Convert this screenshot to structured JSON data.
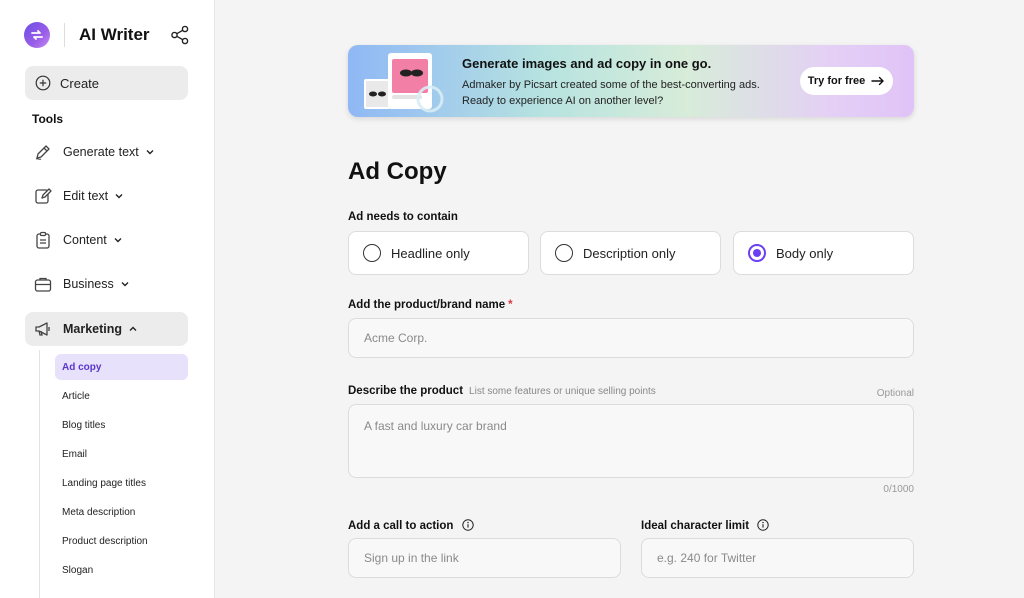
{
  "app": {
    "title": "AI Writer"
  },
  "sidebar": {
    "create_label": "Create",
    "tools_label": "Tools",
    "items": [
      {
        "label": "Generate text",
        "icon": "pen-icon"
      },
      {
        "label": "Edit text",
        "icon": "edit-icon"
      },
      {
        "label": "Content",
        "icon": "clipboard-icon"
      },
      {
        "label": "Business",
        "icon": "briefcase-icon"
      },
      {
        "label": "Marketing",
        "icon": "megaphone-icon"
      }
    ],
    "subitems": [
      {
        "label": "Ad copy"
      },
      {
        "label": "Article"
      },
      {
        "label": "Blog titles"
      },
      {
        "label": "Email"
      },
      {
        "label": "Landing page titles"
      },
      {
        "label": "Meta description"
      },
      {
        "label": "Product description"
      },
      {
        "label": "Slogan"
      }
    ]
  },
  "banner": {
    "title": "Generate images and ad copy in one go.",
    "text": "Admaker by Picsart created some of the best-converting ads. Ready to experience AI on another level?",
    "button_label": "Try for free"
  },
  "form": {
    "page_title": "Ad Copy",
    "contain_label": "Ad needs to contain",
    "options": [
      {
        "label": "Headline only",
        "selected": false
      },
      {
        "label": "Description only",
        "selected": false
      },
      {
        "label": "Body only",
        "selected": true
      }
    ],
    "brand_label": "Add the product/brand name",
    "brand_required": "*",
    "brand_placeholder": "Acme Corp.",
    "describe_label": "Describe the product",
    "describe_hint": "List some features or unique selling points",
    "describe_optional": "Optional",
    "describe_placeholder": "A fast and luxury car brand",
    "describe_counter": "0/1000",
    "cta_label": "Add a call to action",
    "cta_placeholder": "Sign up in the link",
    "limit_label": "Ideal character limit",
    "limit_placeholder": "e.g. 240 for Twitter"
  },
  "colors": {
    "accent": "#6b3ff2",
    "active_sub_bg": "#e8e1fb",
    "active_sub_text": "#5a36c9"
  }
}
